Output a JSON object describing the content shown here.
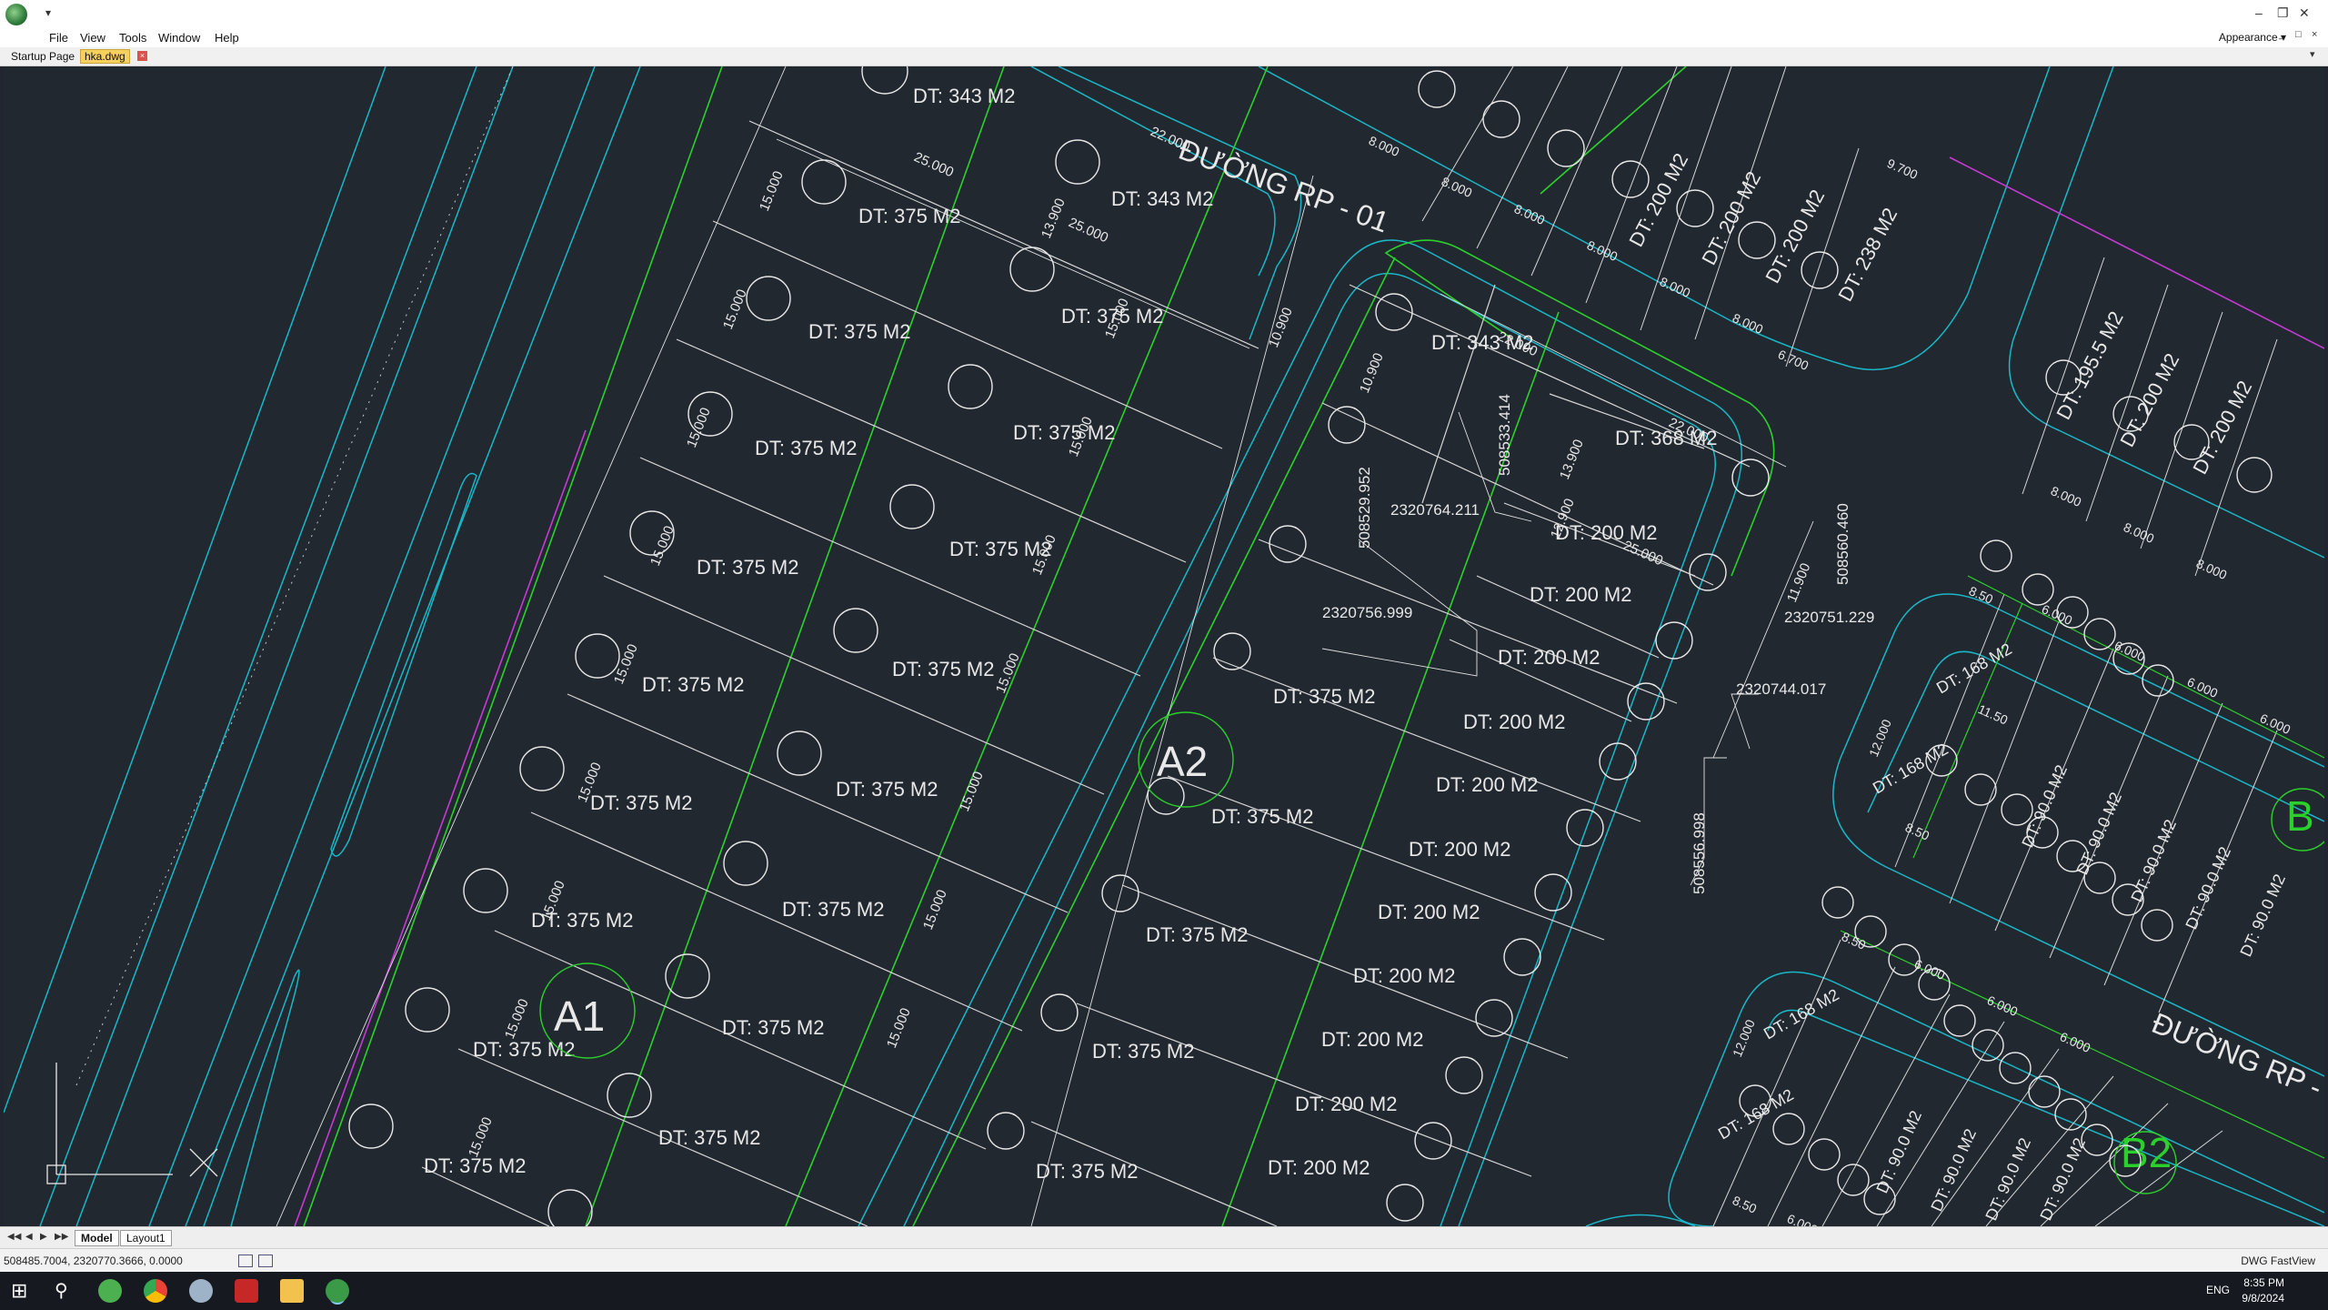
{
  "titlebar": {
    "quick_access": "▾",
    "controls": {
      "minimize": "–",
      "restore": "❐",
      "close": "✕"
    }
  },
  "menu": {
    "file": "File",
    "view": "View",
    "tools": "Tools",
    "window": "Window",
    "help": "Help",
    "appearance": "Appearance ▾"
  },
  "tabs": {
    "startup": "Startup Page",
    "drawing": "hka.dwg",
    "close_glyph": "×"
  },
  "drawing": {
    "road_labels": {
      "rp01": "ĐƯỜNG RP - 01",
      "rp_lower": "ĐƯỜNG RP -"
    },
    "block_labels": {
      "a1": "A1",
      "a2": "A2",
      "b2": "B2",
      "b_partial": "B"
    },
    "area_labels": {
      "dt375": "DT: 375  M2",
      "dt343": "DT: 343  M2",
      "dt368": "DT: 368  M2",
      "dt200": "DT: 200 M2",
      "dt238": "DT: 238 M2",
      "dt195": "DT: 195.5 M2",
      "dt168": "DT: 168 M2",
      "dt90": "DT: 90.0 M2"
    },
    "coordinates": {
      "c1": "2320764.211",
      "c2": "2320756.999",
      "c3": "2320751.229",
      "c4": "2320744.017",
      "v1": "508533.414",
      "v2": "508529.952",
      "v3": "508560.460",
      "v4": "508556.998"
    },
    "dimensions": {
      "d15": "15.000",
      "d25": "25.000",
      "d22": "22.000",
      "d13": "13.900",
      "d12": "12.900",
      "d11": "11.900",
      "d10": "10.900",
      "d8": "8.000",
      "d6": "6.000",
      "d85": "8.50",
      "d115": "11.50",
      "d12b": "12.000",
      "d9": "9.700",
      "d67": "6.700"
    },
    "ucs": {
      "x": "X",
      "y": "Y"
    }
  },
  "layout": {
    "model": "Model",
    "layout1": "Layout1"
  },
  "status": {
    "coords": "508485.7004, 2320770.3666, 0.0000",
    "product": "DWG FastView"
  },
  "taskbar": {
    "lang": "ENG",
    "time": "8:35 PM",
    "date": "9/8/2024"
  },
  "colors": {
    "canvas_bg": "#212830",
    "green": "#2bd12b",
    "cyan": "#19b7c7",
    "white": "#e8e8e8",
    "magenta": "#c83ad6",
    "tab_active": "#f7d160"
  }
}
